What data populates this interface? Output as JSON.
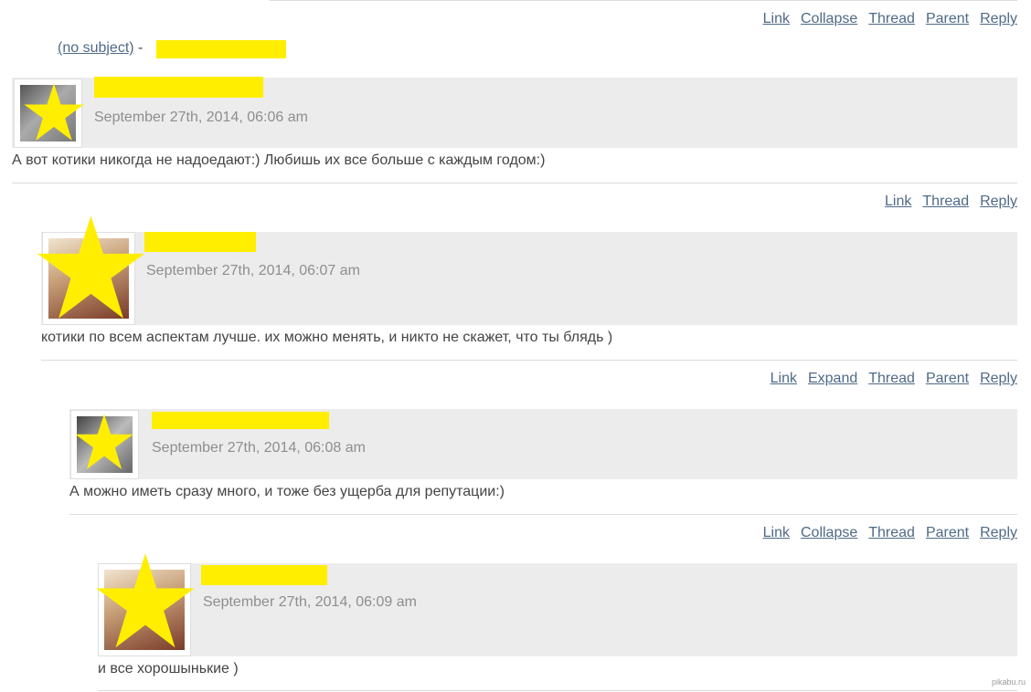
{
  "subject": {
    "link_text": "(no subject)",
    "separator": "-"
  },
  "comments": [
    {
      "actions": [
        "Link",
        "Collapse",
        "Thread",
        "Parent",
        "Reply"
      ],
      "date": "September 27th, 2014, 06:06 am",
      "body": "А вот котики никогда не надоедают:) Любишь их все больше с каждым годом:)"
    },
    {
      "actions": [
        "Link",
        "Thread",
        "Reply"
      ],
      "date": "September 27th, 2014, 06:07 am",
      "body": "котики по всем аспектам лучше. их можно менять, и никто не скажет, что ты блядь )"
    },
    {
      "actions": [
        "Link",
        "Expand",
        "Thread",
        "Parent",
        "Reply"
      ],
      "date": "September 27th, 2014, 06:08 am",
      "body": "А можно иметь сразу много, и тоже без ущерба для репутации:)"
    },
    {
      "actions": [
        "Link",
        "Collapse",
        "Thread",
        "Parent",
        "Reply"
      ],
      "date": "September 27th, 2014, 06:09 am",
      "body": "и все хорошынькие )"
    }
  ],
  "watermark": "pikabu.ru",
  "colors": {
    "redaction": "#ffee00",
    "header_bg": "#ececec",
    "link": "#4f6a86",
    "date": "#8e8e8e"
  }
}
